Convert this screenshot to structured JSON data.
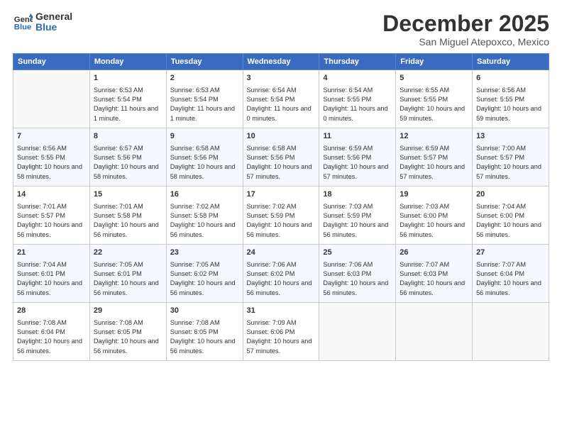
{
  "logo": {
    "line1": "General",
    "line2": "Blue"
  },
  "title": "December 2025",
  "location": "San Miguel Atepoxco, Mexico",
  "weekdays": [
    "Sunday",
    "Monday",
    "Tuesday",
    "Wednesday",
    "Thursday",
    "Friday",
    "Saturday"
  ],
  "weeks": [
    [
      {
        "day": "",
        "empty": true
      },
      {
        "day": "1",
        "sunrise": "6:53 AM",
        "sunset": "5:54 PM",
        "daylight": "11 hours and 1 minute."
      },
      {
        "day": "2",
        "sunrise": "6:53 AM",
        "sunset": "5:54 PM",
        "daylight": "11 hours and 1 minute."
      },
      {
        "day": "3",
        "sunrise": "6:54 AM",
        "sunset": "5:54 PM",
        "daylight": "11 hours and 0 minutes."
      },
      {
        "day": "4",
        "sunrise": "6:54 AM",
        "sunset": "5:55 PM",
        "daylight": "11 hours and 0 minutes."
      },
      {
        "day": "5",
        "sunrise": "6:55 AM",
        "sunset": "5:55 PM",
        "daylight": "10 hours and 59 minutes."
      },
      {
        "day": "6",
        "sunrise": "6:56 AM",
        "sunset": "5:55 PM",
        "daylight": "10 hours and 59 minutes."
      }
    ],
    [
      {
        "day": "7",
        "sunrise": "6:56 AM",
        "sunset": "5:55 PM",
        "daylight": "10 hours and 58 minutes."
      },
      {
        "day": "8",
        "sunrise": "6:57 AM",
        "sunset": "5:56 PM",
        "daylight": "10 hours and 58 minutes."
      },
      {
        "day": "9",
        "sunrise": "6:58 AM",
        "sunset": "5:56 PM",
        "daylight": "10 hours and 58 minutes."
      },
      {
        "day": "10",
        "sunrise": "6:58 AM",
        "sunset": "5:56 PM",
        "daylight": "10 hours and 57 minutes."
      },
      {
        "day": "11",
        "sunrise": "6:59 AM",
        "sunset": "5:56 PM",
        "daylight": "10 hours and 57 minutes."
      },
      {
        "day": "12",
        "sunrise": "6:59 AM",
        "sunset": "5:57 PM",
        "daylight": "10 hours and 57 minutes."
      },
      {
        "day": "13",
        "sunrise": "7:00 AM",
        "sunset": "5:57 PM",
        "daylight": "10 hours and 57 minutes."
      }
    ],
    [
      {
        "day": "14",
        "sunrise": "7:01 AM",
        "sunset": "5:57 PM",
        "daylight": "10 hours and 56 minutes."
      },
      {
        "day": "15",
        "sunrise": "7:01 AM",
        "sunset": "5:58 PM",
        "daylight": "10 hours and 56 minutes."
      },
      {
        "day": "16",
        "sunrise": "7:02 AM",
        "sunset": "5:58 PM",
        "daylight": "10 hours and 56 minutes."
      },
      {
        "day": "17",
        "sunrise": "7:02 AM",
        "sunset": "5:59 PM",
        "daylight": "10 hours and 56 minutes."
      },
      {
        "day": "18",
        "sunrise": "7:03 AM",
        "sunset": "5:59 PM",
        "daylight": "10 hours and 56 minutes."
      },
      {
        "day": "19",
        "sunrise": "7:03 AM",
        "sunset": "6:00 PM",
        "daylight": "10 hours and 56 minutes."
      },
      {
        "day": "20",
        "sunrise": "7:04 AM",
        "sunset": "6:00 PM",
        "daylight": "10 hours and 56 minutes."
      }
    ],
    [
      {
        "day": "21",
        "sunrise": "7:04 AM",
        "sunset": "6:01 PM",
        "daylight": "10 hours and 56 minutes."
      },
      {
        "day": "22",
        "sunrise": "7:05 AM",
        "sunset": "6:01 PM",
        "daylight": "10 hours and 56 minutes."
      },
      {
        "day": "23",
        "sunrise": "7:05 AM",
        "sunset": "6:02 PM",
        "daylight": "10 hours and 56 minutes."
      },
      {
        "day": "24",
        "sunrise": "7:06 AM",
        "sunset": "6:02 PM",
        "daylight": "10 hours and 56 minutes."
      },
      {
        "day": "25",
        "sunrise": "7:06 AM",
        "sunset": "6:03 PM",
        "daylight": "10 hours and 56 minutes."
      },
      {
        "day": "26",
        "sunrise": "7:07 AM",
        "sunset": "6:03 PM",
        "daylight": "10 hours and 56 minutes."
      },
      {
        "day": "27",
        "sunrise": "7:07 AM",
        "sunset": "6:04 PM",
        "daylight": "10 hours and 56 minutes."
      }
    ],
    [
      {
        "day": "28",
        "sunrise": "7:08 AM",
        "sunset": "6:04 PM",
        "daylight": "10 hours and 56 minutes."
      },
      {
        "day": "29",
        "sunrise": "7:08 AM",
        "sunset": "6:05 PM",
        "daylight": "10 hours and 56 minutes."
      },
      {
        "day": "30",
        "sunrise": "7:08 AM",
        "sunset": "6:05 PM",
        "daylight": "10 hours and 56 minutes."
      },
      {
        "day": "31",
        "sunrise": "7:09 AM",
        "sunset": "6:06 PM",
        "daylight": "10 hours and 57 minutes."
      },
      {
        "day": "",
        "empty": true
      },
      {
        "day": "",
        "empty": true
      },
      {
        "day": "",
        "empty": true
      }
    ]
  ],
  "labels": {
    "sunrise": "Sunrise:",
    "sunset": "Sunset:",
    "daylight": "Daylight:"
  }
}
